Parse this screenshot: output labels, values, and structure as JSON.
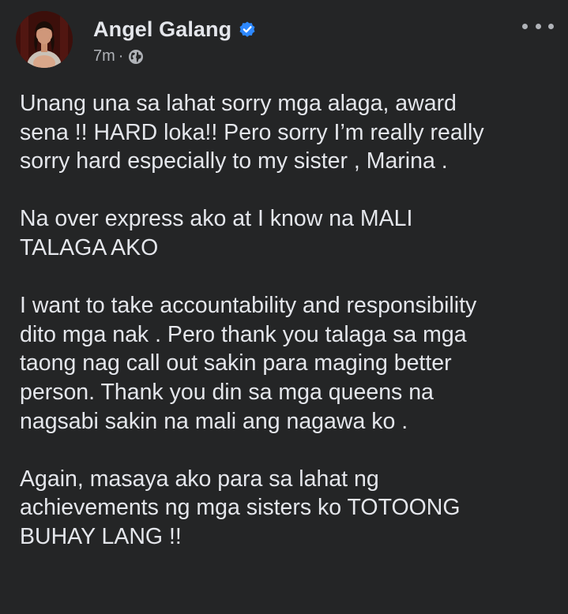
{
  "post": {
    "author": "Angel Galang",
    "verified_icon": "verified-badge-icon",
    "timestamp": "7m",
    "separator": "·",
    "audience_icon": "globe-icon",
    "more_icon": "more-options-icon",
    "colors": {
      "background": "#242526",
      "text": "#e4e6eb",
      "secondary_text": "#b0b3b8",
      "verified": "#2d88ff"
    },
    "paragraphs": [
      {
        "lines": [
          "Unang una sa lahat sorry mga alaga, award",
          "sena !! HARD loka!! Pero sorry I’m really really",
          "sorry hard especially to my sister , Marina ."
        ]
      },
      {
        "lines": [
          "Na over express ako at I know na MALI",
          "TALAGA AKO"
        ]
      },
      {
        "lines": [
          "I want to take accountability and responsibility",
          "dito mga nak . Pero thank you talaga sa mga",
          "taong nag call out sakin para maging better",
          "person. Thank you din sa mga queens na",
          "nagsabi sakin na mali ang nagawa ko ."
        ]
      },
      {
        "lines": [
          "Again, masaya ako para sa lahat ng",
          "achievements ng mga sisters ko TOTOONG",
          "BUHAY LANG !!"
        ]
      }
    ]
  }
}
